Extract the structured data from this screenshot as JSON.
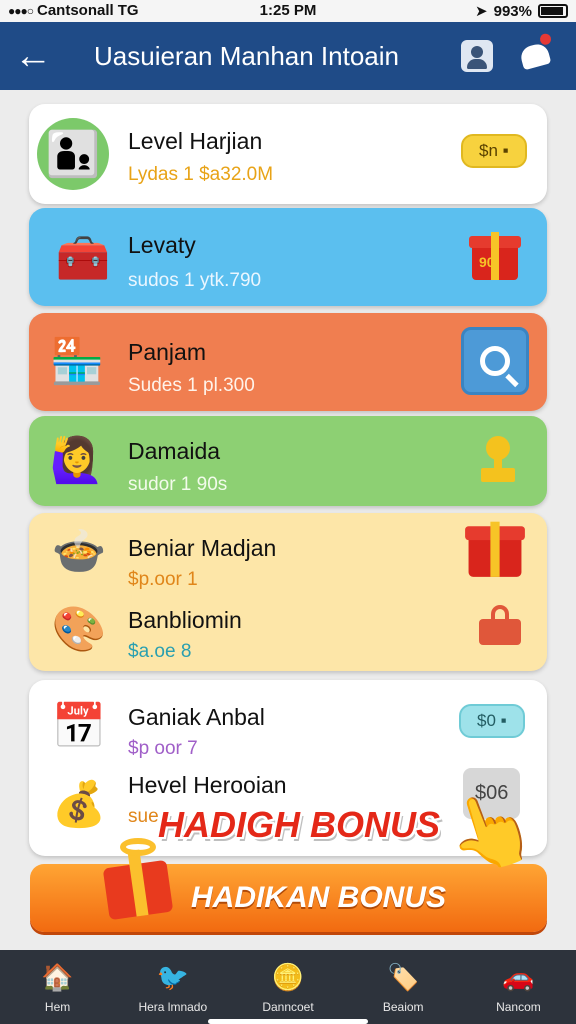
{
  "status_bar": {
    "carrier": "Cantsonall",
    "network": "TG",
    "time": "1:25 PM",
    "battery": "993%"
  },
  "header": {
    "title": "Uasuieran Manhan Intoain"
  },
  "items": [
    {
      "name": "Level Harjian",
      "sub": "Lydas 1 $a32.0M",
      "sub_color": "#e8a317",
      "action": "$n ▪"
    },
    {
      "name": "Levaty",
      "sub": "sudos 1 ytk.790",
      "sub_color": "#eaf6ff",
      "action": "90"
    },
    {
      "name": "Panjam",
      "sub": "Sudes 1 pl.300",
      "sub_color": "#fff3ea"
    },
    {
      "name": "Damaida",
      "sub": "sudor 1 90s",
      "sub_color": "#f2fbeb"
    },
    {
      "name": "Beniar Madjan",
      "sub": "$p.oor 1",
      "sub_color": "#e0861a"
    },
    {
      "name": "Banbliomin",
      "sub": "$a.oe 8",
      "sub_color": "#2a9fb0"
    },
    {
      "name": "Ganiak Anbal",
      "sub": "$p oor 7",
      "sub_color": "#a05fc8",
      "action": "$0 ▪"
    },
    {
      "name": "Hevel Herooian",
      "sub": "sue",
      "sub_color": "#e0861a",
      "action": "$06"
    }
  ],
  "banner": "HADIGH BONUS",
  "bonus_button": {
    "label": "HADIKAN BONUS"
  },
  "nav": [
    {
      "label": "Hem",
      "icon": "home-icon"
    },
    {
      "label": "Hera lmnado",
      "icon": "bird-icon"
    },
    {
      "label": "Danncoet",
      "icon": "coin-icon"
    },
    {
      "label": "Beaiom",
      "icon": "tag-icon"
    },
    {
      "label": "Nancom",
      "icon": "car-icon"
    }
  ]
}
